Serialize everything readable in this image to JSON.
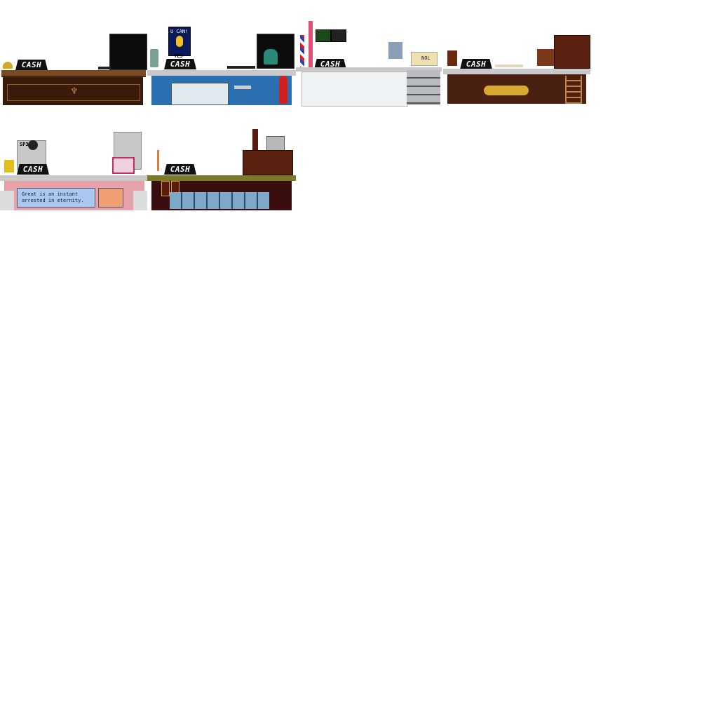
{
  "sprite_sheet": {
    "counters": [
      {
        "id": "wood",
        "cash_label": "CASH"
      },
      {
        "id": "blue",
        "cash_label": "CASH",
        "poster_top": "U CAN!",
        "poster_bottom": "YES"
      },
      {
        "id": "barber",
        "cash_label": "CASH",
        "box_label": "NOL"
      },
      {
        "id": "brown",
        "cash_label": "CASH"
      },
      {
        "id": "pink",
        "cash_label": "CASH",
        "sign_label": "SP3",
        "banner_line1": "Great      is an instant",
        "banner_line2": "arrested in eternity."
      },
      {
        "id": "bar",
        "cash_label": "CASH"
      }
    ]
  },
  "colors": {
    "wood_top": "#7a4a22",
    "wood_body": "#3a1a0a",
    "blue_body": "#2a6fb0",
    "gray_top": "#c9c9c9",
    "white_body": "#eef2f4",
    "brown_body": "#4a2010",
    "pink_body": "#e7a1a8",
    "banner_bg": "#aac8f0",
    "olive_top": "#7a7a2a",
    "bar_body": "#3a0e0e",
    "tiles": "#7fa8c8"
  }
}
